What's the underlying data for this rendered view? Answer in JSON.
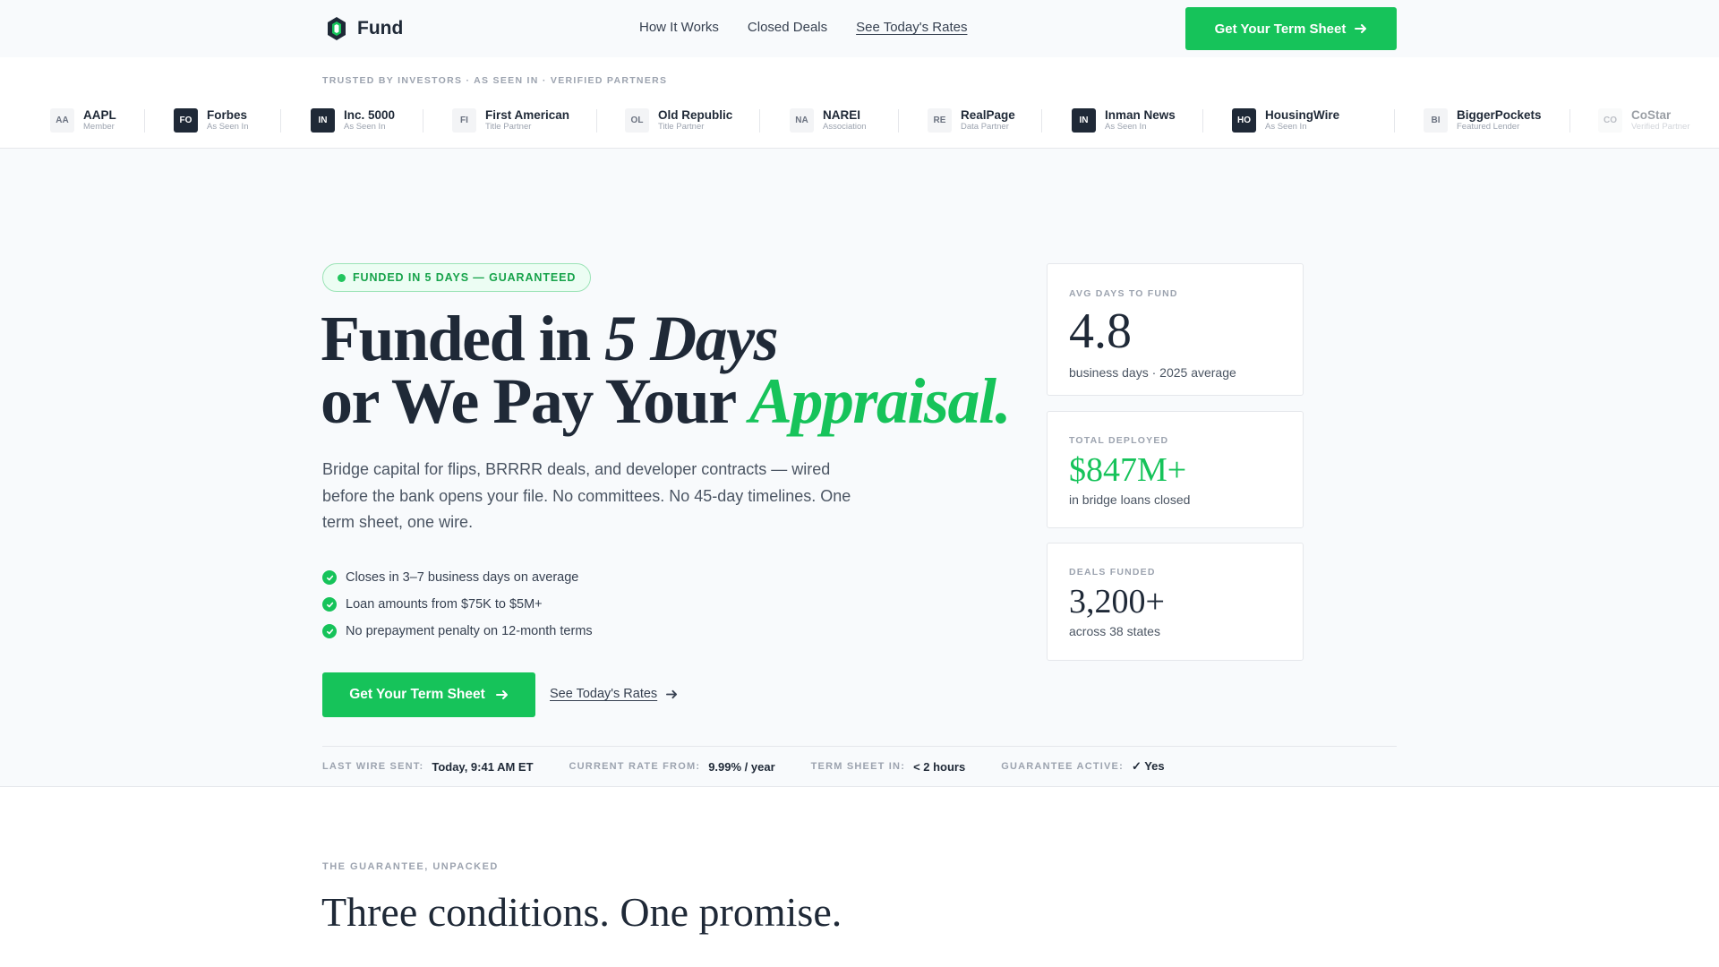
{
  "header": {
    "brand": "Fund",
    "nav": [
      "How It Works",
      "Closed Deals",
      "See Today's Rates"
    ],
    "cta": "Get Your Term Sheet"
  },
  "partners": {
    "label": "TRUSTED BY INVESTORS · AS SEEN IN · VERIFIED PARTNERS",
    "items": [
      {
        "badge": "AA",
        "name": "AAPL",
        "sub": "Member",
        "style": "light"
      },
      {
        "badge": "FO",
        "name": "Forbes",
        "sub": "As Seen In",
        "style": "dark"
      },
      {
        "badge": "IN",
        "name": "Inc. 5000",
        "sub": "As Seen In",
        "style": "dark"
      },
      {
        "badge": "FI",
        "name": "First American",
        "sub": "Title Partner",
        "style": "light"
      },
      {
        "badge": "OL",
        "name": "Old Republic",
        "sub": "Title Partner",
        "style": "light"
      },
      {
        "badge": "NA",
        "name": "NAREI",
        "sub": "Association",
        "style": "light"
      },
      {
        "badge": "RE",
        "name": "RealPage",
        "sub": "Data Partner",
        "style": "light"
      },
      {
        "badge": "IN",
        "name": "Inman News",
        "sub": "As Seen In",
        "style": "dark"
      },
      {
        "badge": "HO",
        "name": "HousingWire",
        "sub": "As Seen In",
        "style": "dark"
      },
      {
        "badge": "BI",
        "name": "BiggerPockets",
        "sub": "Featured Lender",
        "style": "light"
      },
      {
        "badge": "CO",
        "name": "CoStar",
        "sub": "Verified Partner",
        "style": "light"
      }
    ]
  },
  "hero": {
    "pill": "FUNDED IN 5 DAYS — GUARANTEED",
    "headline": {
      "l1a": "Funded in ",
      "l1b": "5 Days",
      "l2a": "or We Pay Your ",
      "l2b": "Appraisal."
    },
    "lead": "Bridge capital for flips, BRRRR deals, and developer contracts — wired before the bank opens your file. No committees. No 45-day timelines. One term sheet, one wire.",
    "bullets": [
      "Closes in 3–7 business days on average",
      "Loan amounts from $75K to $5M+",
      "No prepayment penalty on 12-month terms"
    ],
    "cta": "Get Your Term Sheet",
    "secondary": "See Today's Rates"
  },
  "status": [
    {
      "k": "LAST WIRE SENT:",
      "v": "Today, 9:41 AM ET"
    },
    {
      "k": "CURRENT RATE FROM:",
      "v": "9.99% / year"
    },
    {
      "k": "TERM SHEET IN:",
      "v": "< 2 hours"
    },
    {
      "k": "GUARANTEE ACTIVE:",
      "v": "✓ Yes"
    }
  ],
  "stats": [
    {
      "k": "AVG DAYS TO FUND",
      "v": "4.8",
      "s": "business days · 2025 average"
    },
    {
      "k": "TOTAL DEPLOYED",
      "v": "$847M+",
      "s": "in bridge loans closed"
    },
    {
      "k": "DEALS FUNDED",
      "v": "3,200+",
      "s": "across 38 states"
    }
  ],
  "section": {
    "eyebrow": "THE GUARANTEE, UNPACKED",
    "title": "Three conditions. One promise."
  },
  "colors": {
    "accent": "#16c35a",
    "text": "#1f2937",
    "muted": "#9ca3af"
  },
  "icons": {
    "brand": "shield-logo-icon",
    "arrow": "arrow-right-icon",
    "check": "check-circle-icon"
  }
}
